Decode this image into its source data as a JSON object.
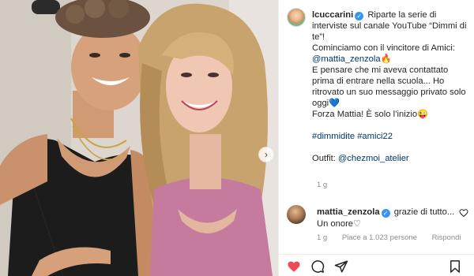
{
  "post": {
    "author": "lcuccarini",
    "caption_line1": "Riparte la serie di interviste sul canale YouTube “Dimmi di te”!",
    "caption_line2_prefix": "Cominciamo con il vincitore di Amici: ",
    "caption_mention": "@mattia_zenzola",
    "caption_line2_emoji": "🔥",
    "caption_line3": "E pensare che mi aveva contattato prima di entrare nella scuola... Ho ritrovato un suo messaggio privato solo oggi",
    "caption_line3_emoji": "💙",
    "caption_line4": "Forza Mattia! È solo l’inizio",
    "caption_line4_emoji": "😜",
    "hashtags": "#dimmidite #amici22",
    "outfit_label": "Outfit: ",
    "outfit_mention": "@chezmoi_atelier",
    "time_ago": "1 g"
  },
  "comment": {
    "author": "mattia_zenzola",
    "text": "grazie di tutto... Un onore♡",
    "time_ago": "1 g",
    "likes": "Piace a 1.023 persone",
    "reply_label": "Rispondi"
  },
  "icons": {
    "verified": "verified-badge-icon",
    "like": "heart-filled-icon",
    "comment": "comment-bubble-icon",
    "share": "paper-plane-icon",
    "save": "bookmark-icon",
    "next": "chevron-right-icon"
  },
  "colors": {
    "verified_blue": "#3797f0",
    "like_red": "#ed4956",
    "link": "#00376b",
    "muted": "#8e8e8e"
  }
}
